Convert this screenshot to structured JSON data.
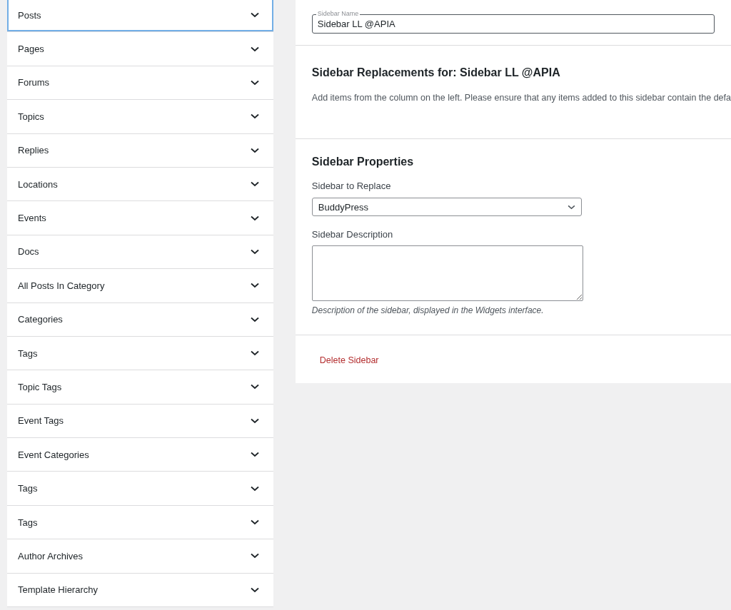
{
  "post_types": [
    {
      "label": "Posts",
      "selected": true
    },
    {
      "label": "Pages",
      "selected": false
    },
    {
      "label": "Forums",
      "selected": false
    },
    {
      "label": "Topics",
      "selected": false
    },
    {
      "label": "Replies",
      "selected": false
    },
    {
      "label": "Locations",
      "selected": false
    },
    {
      "label": "Events",
      "selected": false
    },
    {
      "label": "Docs",
      "selected": false
    },
    {
      "label": "All Posts In Category",
      "selected": false
    },
    {
      "label": "Categories",
      "selected": false
    },
    {
      "label": "Tags",
      "selected": false
    },
    {
      "label": "Topic Tags",
      "selected": false
    },
    {
      "label": "Event Tags",
      "selected": false
    },
    {
      "label": "Event Categories",
      "selected": false
    },
    {
      "label": "Tags",
      "selected": false
    },
    {
      "label": "Tags",
      "selected": false
    },
    {
      "label": "Author Archives",
      "selected": false
    },
    {
      "label": "Template Hierarchy",
      "selected": false
    }
  ],
  "sidebar_name": {
    "label": "Sidebar Name",
    "value": "Sidebar LL @APIA"
  },
  "replacements": {
    "heading": "Sidebar Replacements for: Sidebar LL @APIA",
    "text": "Add items from the column on the left. Please ensure that any items added to this sidebar contain the defa"
  },
  "properties": {
    "heading": "Sidebar Properties",
    "replace_label": "Sidebar to Replace",
    "replace_value": "BuddyPress",
    "description_label": "Sidebar Description",
    "description_help": "Description of the sidebar, displayed in the Widgets interface."
  },
  "delete_link": "Delete Sidebar"
}
